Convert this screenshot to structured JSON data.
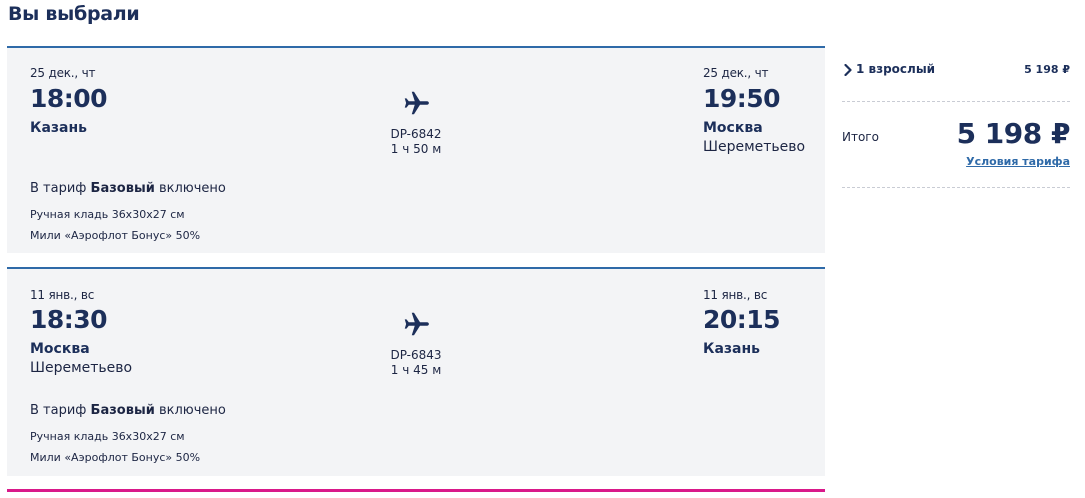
{
  "page": {
    "title": "Вы выбрали"
  },
  "colors": {
    "accent": "#2f6aa8",
    "text": "#1c2f5a",
    "card_bg": "#f3f4f6",
    "pink_bar": "#d9198a"
  },
  "flights": [
    {
      "dep_date": "25 дек., чт",
      "dep_time": "18:00",
      "dep_city": "Казань",
      "dep_airport": "",
      "flight_no": "DP-6842",
      "duration": "1 ч 50 м",
      "arr_date": "25 дек., чт",
      "arr_time": "19:50",
      "arr_city": "Москва",
      "arr_airport": "Шереметьево",
      "tariff_prefix": "В тариф ",
      "tariff_name": "Базовый",
      "tariff_suffix": " включено",
      "perks": [
        "Ручная кладь 36x30x27 см",
        "Мили «Аэрофлот Бонус» 50%"
      ],
      "icon": "airplane-icon"
    },
    {
      "dep_date": "11 янв., вс",
      "dep_time": "18:30",
      "dep_city": "Москва",
      "dep_airport": "Шереметьево",
      "flight_no": "DP-6843",
      "duration": "1 ч 45 м",
      "arr_date": "11 янв., вс",
      "arr_time": "20:15",
      "arr_city": "Казань",
      "arr_airport": "",
      "tariff_prefix": "В тариф ",
      "tariff_name": "Базовый",
      "tariff_suffix": " включено",
      "perks": [
        "Ручная кладь 36x30x27 см",
        "Мили «Аэрофлот Бонус» 50%"
      ],
      "icon": "airplane-icon"
    }
  ],
  "summary": {
    "passengers_label": "1 взрослый",
    "passengers_price": "5 198 ₽",
    "total_label": "Итого",
    "total_amount": "5 198 ₽",
    "tariff_link": "Условия тарифа",
    "chevron_icon": "chevron-right-icon"
  }
}
